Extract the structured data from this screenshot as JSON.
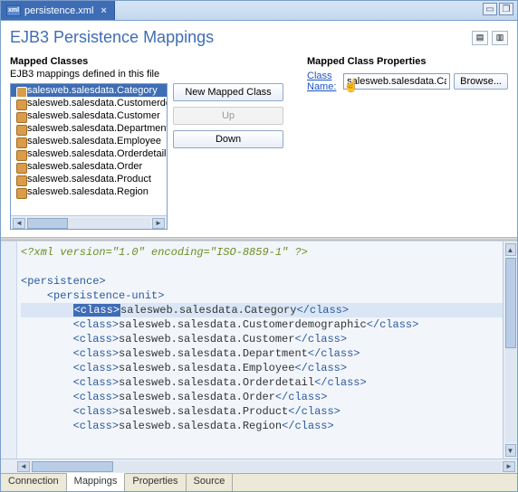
{
  "tab": {
    "filename": "persistence.xml"
  },
  "page": {
    "title": "EJB3 Persistence Mappings"
  },
  "mapped": {
    "heading": "Mapped Classes",
    "subtext": "EJB3 mappings defined in this file",
    "items": [
      "salesweb.salesdata.Category",
      "salesweb.salesdata.Customerdemographic",
      "salesweb.salesdata.Customer",
      "salesweb.salesdata.Department",
      "salesweb.salesdata.Employee",
      "salesweb.salesdata.Orderdetail",
      "salesweb.salesdata.Order",
      "salesweb.salesdata.Product",
      "salesweb.salesdata.Region"
    ],
    "selected_index": 0,
    "buttons": {
      "new": "New Mapped Class",
      "up": "Up",
      "down": "Down"
    }
  },
  "props": {
    "heading": "Mapped Class Properties",
    "class_name_label": "Class Name:",
    "class_name_value": "salesweb.salesdata.Category",
    "browse": "Browse..."
  },
  "source": {
    "decl": "<?xml version=\"1.0\" encoding=\"ISO-8859-1\" ?>",
    "root_open": "<persistence>",
    "unit_open": "<persistence-unit>",
    "class_tag": "class",
    "lines": [
      "salesweb.salesdata.Category",
      "salesweb.salesdata.Customerdemographic",
      "salesweb.salesdata.Customer",
      "salesweb.salesdata.Department",
      "salesweb.salesdata.Employee",
      "salesweb.salesdata.Orderdetail",
      "salesweb.salesdata.Order",
      "salesweb.salesdata.Product",
      "salesweb.salesdata.Region"
    ]
  },
  "bottom_tabs": [
    "Connection",
    "Mappings",
    "Properties",
    "Source"
  ],
  "bottom_active": 1
}
